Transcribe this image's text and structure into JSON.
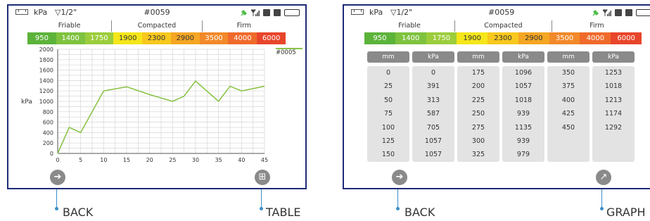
{
  "status": {
    "unit": "kPa",
    "tip": "▽1/2\"",
    "record_id": "#0059",
    "battery_color": "#4fbf4a"
  },
  "zones": {
    "headers": [
      "Friable",
      "Compacted",
      "Firm"
    ],
    "values": [
      "950",
      "1400",
      "1750",
      "1900",
      "2300",
      "2900",
      "3500",
      "4000",
      "6000"
    ],
    "colors": [
      "#5cb33a",
      "#7ec23f",
      "#9ccd3c",
      "#f5e61a",
      "#f8c81d",
      "#f5a623",
      "#f2892a",
      "#ef6a2b",
      "#e8452a"
    ]
  },
  "chart_data": {
    "type": "line",
    "ylabel": "kPa",
    "xlim": [
      0,
      45
    ],
    "ylim": [
      0,
      2000
    ],
    "x_ticks": [
      "0",
      "5",
      "10",
      "15",
      "20",
      "25",
      "30",
      "35",
      "40",
      "45"
    ],
    "y_ticks": [
      "0",
      "200",
      "400",
      "600",
      "800",
      "1000",
      "1200",
      "1400",
      "1600",
      "1800",
      "2000"
    ],
    "grid": true,
    "legend_position": "top-right",
    "series": [
      {
        "name": "#0005",
        "color": "#8bc34a",
        "x": [
          0,
          2.5,
          5,
          7.5,
          10,
          15,
          20,
          25,
          27.5,
          30,
          35,
          37.5,
          40,
          45
        ],
        "y": [
          0,
          500,
          400,
          800,
          1200,
          1280,
          1130,
          1000,
          1100,
          1390,
          1000,
          1290,
          1200,
          1290
        ]
      }
    ]
  },
  "table": {
    "headers": [
      "mm",
      "kPa",
      "mm",
      "kPa",
      "mm",
      "kPa"
    ],
    "columns": [
      [
        "0",
        "25",
        "50",
        "75",
        "100",
        "125",
        "150"
      ],
      [
        "0",
        "391",
        "313",
        "587",
        "705",
        "1057",
        "1057"
      ],
      [
        "175",
        "200",
        "225",
        "250",
        "275",
        "300",
        "325"
      ],
      [
        "1096",
        "1057",
        "1018",
        "939",
        "1135",
        "939",
        "979"
      ],
      [
        "350",
        "375",
        "400",
        "425",
        "450"
      ],
      [
        "1253",
        "1018",
        "1213",
        "1174",
        "1292"
      ]
    ]
  },
  "callouts": {
    "back_left": "BACK",
    "table": "TABLE",
    "back_right": "BACK",
    "graph": "GRAPH"
  }
}
